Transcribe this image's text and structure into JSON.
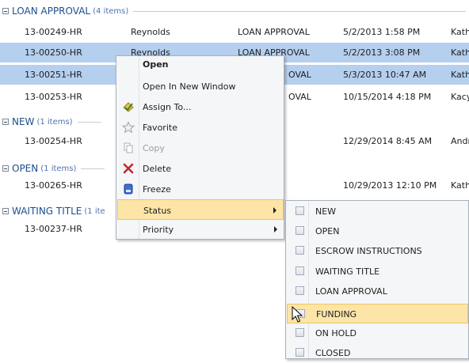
{
  "groups": [
    {
      "name": "LOAN APPROVAL",
      "count": "(4 items)"
    },
    {
      "name": "NEW",
      "count": "(1 items)"
    },
    {
      "name": "OPEN",
      "count": "(1 items)"
    },
    {
      "name": "WAITING TITLE",
      "count": "(1 ite"
    }
  ],
  "rows": [
    {
      "id": "13-00249-HR",
      "name": "Reynolds",
      "status": "LOAN APPROVAL",
      "date": "5/2/2013 1:58 PM",
      "user": "Kath"
    },
    {
      "id": "13-00250-HR",
      "name": "Reynolds",
      "status": "LOAN APPROVAL",
      "date": "5/2/2013 3:08 PM",
      "user": "Kath"
    },
    {
      "id": "13-00251-HR",
      "status_tail": "OVAL",
      "date": "5/3/2013 10:47 AM",
      "user": "Kath"
    },
    {
      "id": "13-00253-HR",
      "status_tail": "OVAL",
      "date": "10/15/2014 4:18 PM",
      "user": "Kacy"
    },
    {
      "id": "13-00254-HR",
      "date": "12/29/2014 8:45 AM",
      "user": "Andr"
    },
    {
      "id": "13-00265-HR",
      "date": "10/29/2013 12:10 PM",
      "user": "Kath"
    },
    {
      "id": "13-00237-HR"
    }
  ],
  "context_menu": {
    "open": "Open",
    "open_new_window": "Open In New Window",
    "assign_to": "Assign To...",
    "favorite": "Favorite",
    "copy": "Copy",
    "delete": "Delete",
    "freeze": "Freeze",
    "status": "Status",
    "priority": "Priority"
  },
  "status_submenu": [
    "NEW",
    "OPEN",
    "ESCROW INSTRUCTIONS",
    "WAITING TITLE",
    "LOAN APPROVAL",
    "FUNDING",
    "ON HOLD",
    "CLOSED"
  ],
  "colors": {
    "selected_row": "#b5cfee",
    "highlight": "#fde5a8",
    "group_text": "#1d4e8f",
    "delete_icon": "#c0282d"
  }
}
